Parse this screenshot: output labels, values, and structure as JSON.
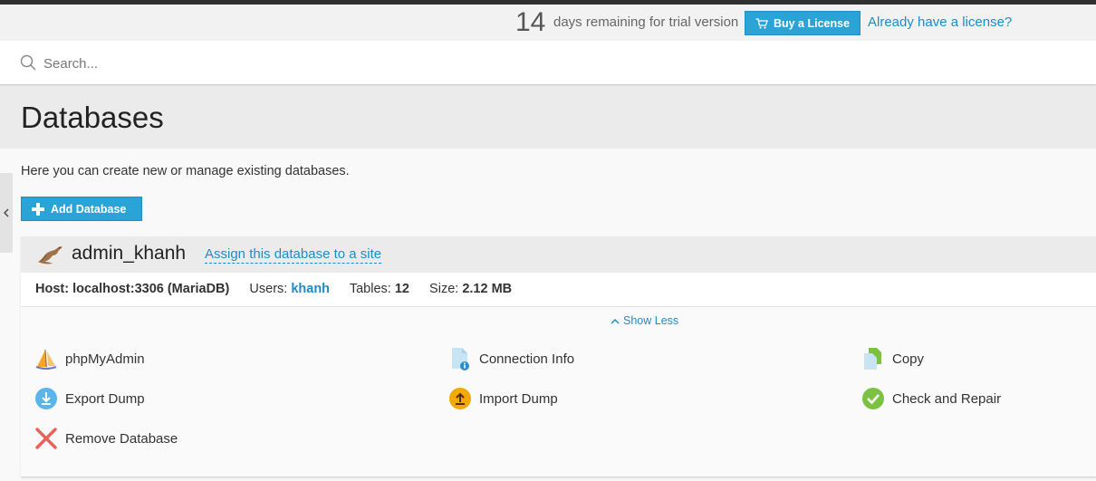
{
  "trial": {
    "days": "14",
    "text": "days remaining for trial version",
    "buy_label": "Buy a License",
    "already_label": "Already have a license?"
  },
  "search": {
    "placeholder": "Search..."
  },
  "page": {
    "title": "Databases",
    "intro": "Here you can create new or manage existing databases.",
    "add_label": "Add Database"
  },
  "database": {
    "name": "admin_khanh",
    "assign_label": "Assign this database to a site",
    "host_label": "Host:",
    "host_value": "localhost:3306 (MariaDB)",
    "users_label": "Users:",
    "users_value": "khanh",
    "tables_label": "Tables:",
    "tables_value": "12",
    "size_label": "Size:",
    "size_value": "2.12 MB",
    "show_less": "Show Less",
    "actions": [
      {
        "label": "phpMyAdmin",
        "icon": "phpmyadmin-icon"
      },
      {
        "label": "Connection Info",
        "icon": "connection-info-icon"
      },
      {
        "label": "Copy",
        "icon": "copy-icon"
      },
      {
        "label": "Export Dump",
        "icon": "export-dump-icon"
      },
      {
        "label": "Import Dump",
        "icon": "import-dump-icon"
      },
      {
        "label": "Check and Repair",
        "icon": "check-repair-icon"
      },
      {
        "label": "Remove Database",
        "icon": "remove-icon"
      }
    ]
  },
  "colors": {
    "accent": "#2aa3d6",
    "link": "#1e8cc6",
    "success": "#7cc242",
    "danger": "#e8615a",
    "import": "#f2a900"
  }
}
